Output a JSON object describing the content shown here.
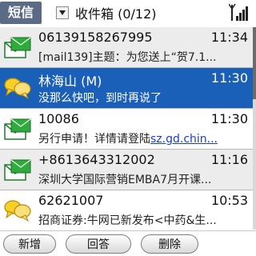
{
  "header": {
    "app_title": "短信",
    "folder": "收件箱 (0/12)"
  },
  "messages": [
    {
      "sender": "06139158267995",
      "time": "11:34",
      "preview": "[mail139]主题：为您送上“贺7.1...",
      "link": "",
      "state": "read",
      "icon": "envelope-icon"
    },
    {
      "sender": "林海山 (M)",
      "time": "11:30",
      "preview": "没那么快吧，到时再说了",
      "link": "",
      "state": "selected",
      "icon": "chat-bubbles-icon"
    },
    {
      "sender": "10086",
      "time": "11:30",
      "preview": "另行申请！详情请登陆",
      "link": "sz.gd.chin...",
      "state": "unread",
      "icon": "envelope-icon"
    },
    {
      "sender": "+8613643312002",
      "time": "11:16",
      "preview": "深圳大学国际营销EMBA7月开课...",
      "link": "",
      "state": "read",
      "icon": "envelope-icon"
    },
    {
      "sender": "62621007",
      "time": "10:53",
      "preview": "招商证券:牛网已新发布<中药&生...",
      "link": "",
      "state": "unread",
      "icon": "chat-bubbles-icon"
    }
  ],
  "buttons": {
    "new": "新增",
    "reply": "回答",
    "delete": "删除"
  },
  "colors": {
    "selected_row": "#1a5fb8",
    "title_badge": "#5b6b86",
    "read_row": "#ececec"
  }
}
